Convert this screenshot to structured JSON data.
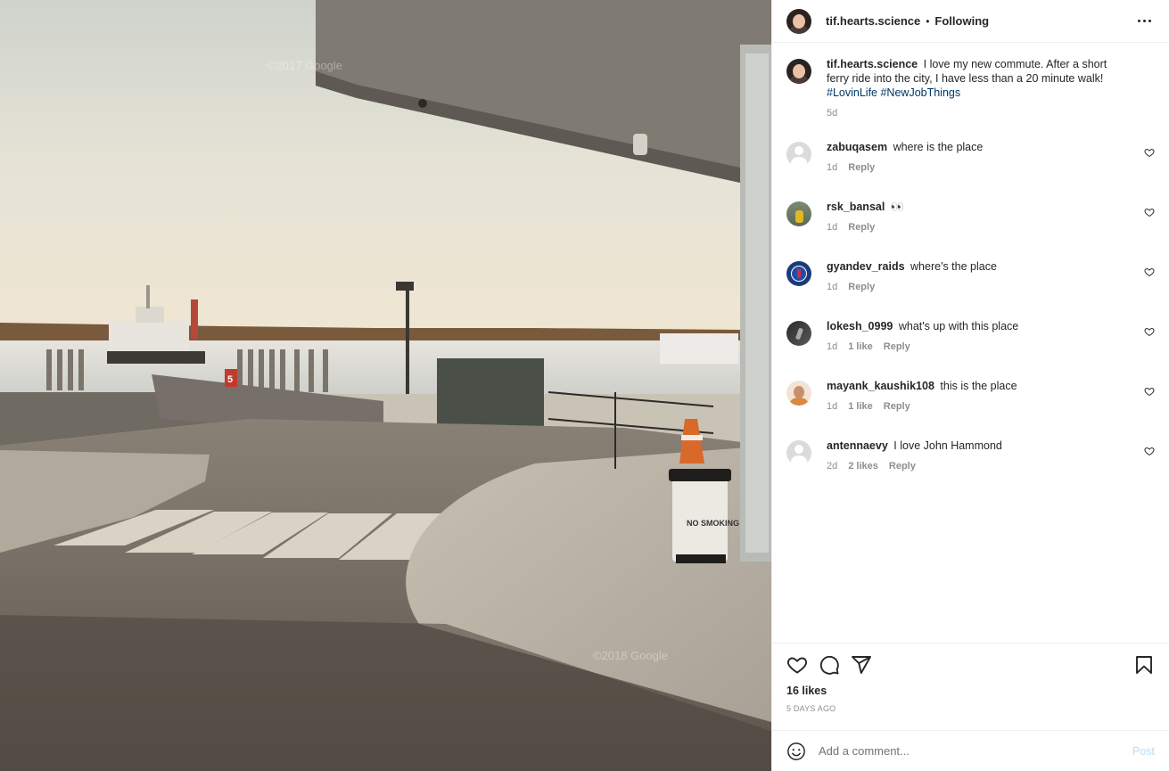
{
  "post": {
    "username": "tif.hearts.science",
    "dot": "•",
    "follow_status": "Following",
    "more_icon": "more-horizontal-icon"
  },
  "photo": {
    "watermark_top": "©2017 Google",
    "watermark_bottom": "©2018 Google",
    "sign_text": "NO SMOKING",
    "lane_number": "5"
  },
  "caption": {
    "username": "tif.hearts.science",
    "text": "I love my new commute. After a short ferry ride into the city, I have less than a 20 minute walk!",
    "hashtags": [
      "#LovinLife",
      "#NewJobThings"
    ],
    "time": "5d"
  },
  "comments": [
    {
      "username": "zabuqasem",
      "text": "where is the place",
      "time": "1d",
      "likes": "",
      "reply": "Reply"
    },
    {
      "username": "rsk_bansal",
      "text": "👀",
      "time": "1d",
      "likes": "",
      "reply": "Reply"
    },
    {
      "username": "gyandev_raids",
      "text": "where's the place",
      "time": "1d",
      "likes": "",
      "reply": "Reply"
    },
    {
      "username": "lokesh_0999",
      "text": "what's up with this place",
      "time": "1d",
      "likes": "1 like",
      "reply": "Reply"
    },
    {
      "username": "mayank_kaushik108",
      "text": "this is the place",
      "time": "1d",
      "likes": "1 like",
      "reply": "Reply"
    },
    {
      "username": "antennaevy",
      "text": "I love John Hammond",
      "time": "2d",
      "likes": "2 likes",
      "reply": "Reply"
    }
  ],
  "footer": {
    "icons": [
      "heart-icon",
      "comment-icon",
      "share-icon",
      "bookmark-icon"
    ],
    "likes_count": "16 likes",
    "date": "5 DAYS AGO",
    "comment_placeholder": "Add a comment...",
    "post_label": "Post"
  },
  "colors": {
    "link": "#00376b",
    "muted": "#8e8e8e",
    "post_disabled": "#b2dffc",
    "text": "#262626"
  }
}
